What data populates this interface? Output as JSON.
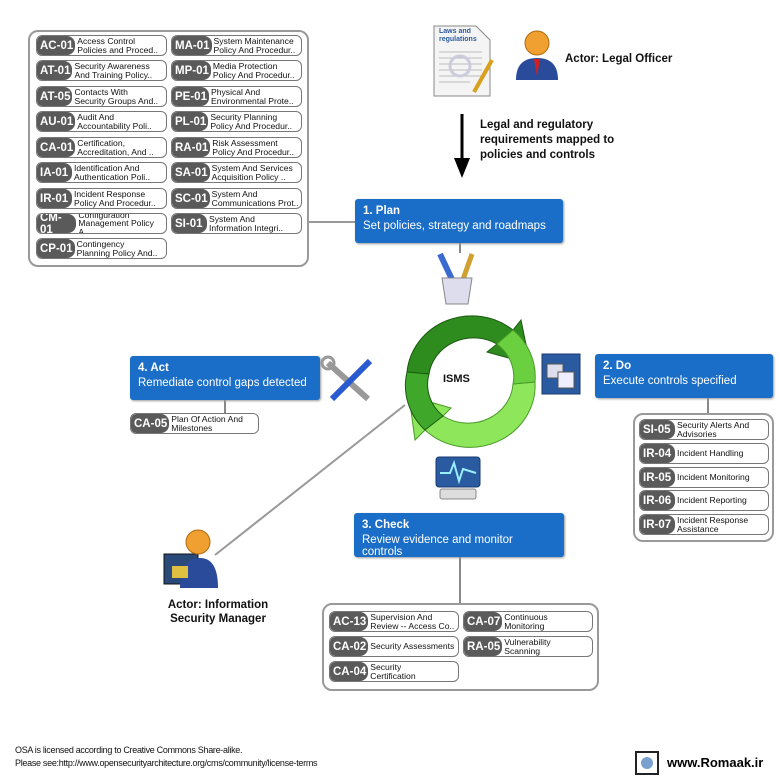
{
  "plan_controls": [
    [
      "AC-01",
      "Access Control\nPolicies and Proced.."
    ],
    [
      "AT-01",
      "Security Awareness\nAnd Training Policy.."
    ],
    [
      "AT-05",
      "Contacts With\nSecurity Groups And.."
    ],
    [
      "AU-01",
      "Audit And\nAccountability Poli.."
    ],
    [
      "CA-01",
      "Certification,\nAccreditation, And .."
    ],
    [
      "IA-01",
      "Identification And\nAuthentication Poli.."
    ],
    [
      "IR-01",
      "Incident Response\nPolicy And Procedur.."
    ],
    [
      "CM-01",
      "Configuration\nManagement Policy A.."
    ],
    [
      "CP-01",
      "Contingency\nPlanning Policy And.."
    ],
    [
      "MA-01",
      "System Maintenance\nPolicy And Procedur.."
    ],
    [
      "MP-01",
      "Media Protection\nPolicy And Procedur.."
    ],
    [
      "PE-01",
      "Physical And\nEnvironmental Prote.."
    ],
    [
      "PL-01",
      "Security Planning\nPolicy And Procedur.."
    ],
    [
      "RA-01",
      "Risk Assessment\nPolicy And Procedur.."
    ],
    [
      "SA-01",
      "System And Services\nAcquisition Policy .."
    ],
    [
      "SC-01",
      "System And\nCommunications Prot.."
    ],
    [
      "SI-01",
      "System And\nInformation Integri.."
    ]
  ],
  "do_controls": [
    [
      "SI-05",
      "Security Alerts And\nAdvisories"
    ],
    [
      "IR-04",
      "Incident Handling"
    ],
    [
      "IR-05",
      "Incident Monitoring"
    ],
    [
      "IR-06",
      "Incident Reporting"
    ],
    [
      "IR-07",
      "Incident Response\nAssistance"
    ]
  ],
  "check_controls": [
    [
      "AC-13",
      "Supervision And\nReview -- Access Co.."
    ],
    [
      "CA-02",
      "Security Assessments"
    ],
    [
      "CA-04",
      "Security\nCertification"
    ],
    [
      "CA-07",
      "Continuous\nMonitoring"
    ],
    [
      "RA-05",
      "Vulnerability\nScanning"
    ]
  ],
  "act_controls": [
    [
      "CA-05",
      "Plan Of Action And\nMilestones"
    ]
  ],
  "phases": {
    "plan": {
      "title": "1. Plan",
      "subtitle": "Set policies, strategy and roadmaps"
    },
    "do": {
      "title": "2. Do",
      "subtitle": "Execute controls specified"
    },
    "check": {
      "title": "3. Check",
      "subtitle": "Review evidence and monitor controls"
    },
    "act": {
      "title": "4. Act",
      "subtitle": "Remediate control gaps detected"
    }
  },
  "center_label": "ISMS",
  "legal_doc_label": "Laws and\nregulations",
  "legal_actor": "Actor: Legal Officer",
  "legal_arrow_text": "Legal and regulatory\nrequirements mapped to\npolicies and controls",
  "manager_actor": "Actor: Information\nSecurity Manager",
  "footer": {
    "line1": "OSA is licensed according to Creative Commons Share-alike.",
    "line2": "Please see:http://www.opensecurityarchitecture.org/cms/community/license-terms",
    "site": "www.Romaak.ir"
  },
  "colors": {
    "phase": "#1a6ec8",
    "code": "#5a5a5a",
    "cycle_dark": "#2e8b1e",
    "cycle_light": "#8ee65a"
  }
}
